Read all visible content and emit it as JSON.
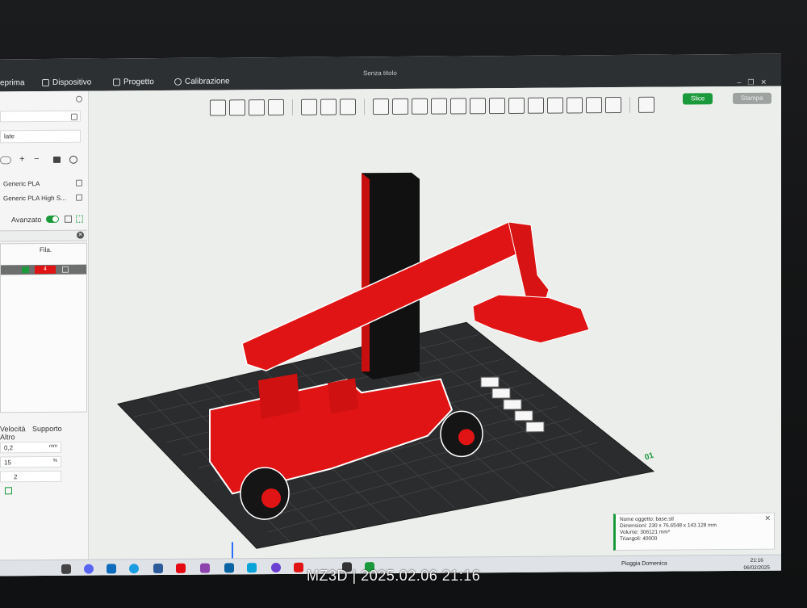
{
  "window": {
    "title": "Senza titolo"
  },
  "menu": {
    "tabs": [
      {
        "label": "eprima",
        "icon": "eye-icon"
      },
      {
        "label": "Dispositivo",
        "icon": "device-icon"
      },
      {
        "label": "Progetto",
        "icon": "project-icon"
      },
      {
        "label": "Calibrazione",
        "icon": "calibration-icon"
      }
    ]
  },
  "left_panel": {
    "plate_label": "late",
    "filaments": [
      "Generic PLA",
      "Generic PLA High S..."
    ],
    "advanced_label": "Avanzato",
    "fila_header": "Fila.",
    "fila_value": "4",
    "param_tabs": [
      "Velocità",
      "Supporto",
      "Altro"
    ],
    "layer_height": {
      "value": "0,2",
      "unit": "mm"
    },
    "infill": {
      "value": "15",
      "unit": "%"
    },
    "walls": {
      "value": "2"
    }
  },
  "toolbar": {
    "slice_label": "Slice",
    "print_label": "Stampa"
  },
  "object_info": {
    "name_line": "Nome oggetto: base.stl",
    "dimensions_line": "Dimensioni: 230 x 76.6548 x 143.128 mm",
    "volume_line": "Volume: 306121 mm³",
    "triangles_line": "Triangoli: 40000"
  },
  "build_plate": {
    "corner_label": "01"
  },
  "taskbar": {
    "weather": "Pioggia Domenica",
    "time": "21:16",
    "date": "06/02/2025"
  },
  "photo_watermark": "MZ3D  |  2025.02.06 21:16",
  "colors": {
    "accent_green": "#1b9a3c",
    "model_red": "#e01414",
    "plate": "#2b2c2d"
  }
}
